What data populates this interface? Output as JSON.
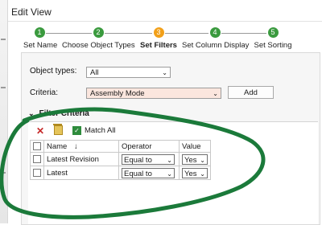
{
  "window": {
    "title": "Edit View"
  },
  "steps": [
    {
      "number": "1",
      "label": "Set Name",
      "state": "done"
    },
    {
      "number": "2",
      "label": "Choose Object Types",
      "state": "done"
    },
    {
      "number": "3",
      "label": "Set Filters",
      "state": "active"
    },
    {
      "number": "4",
      "label": "Set Column Display",
      "state": "done"
    },
    {
      "number": "5",
      "label": "Set Sorting",
      "state": "done"
    }
  ],
  "form": {
    "object_types_label": "Object types:",
    "object_types_value": "All",
    "criteria_label": "Criteria:",
    "criteria_value": "Assembly Mode",
    "add_label": "Add"
  },
  "filter": {
    "section_title": "Filter Criteria",
    "match_all_label": "Match All",
    "match_all_checked": true,
    "columns": {
      "name": "Name",
      "sort_indicator": "↓",
      "operator": "Operator",
      "value": "Value"
    },
    "rows": [
      {
        "name": "Latest Revision",
        "operator": "Equal to",
        "value": "Yes"
      },
      {
        "name": "Latest",
        "operator": "Equal to",
        "value": "Yes"
      }
    ]
  },
  "colors": {
    "step_done": "#3a9a3e",
    "step_active": "#f2a019",
    "annotation_marker": "#1b7a3a",
    "delete_icon": "#c62828"
  },
  "icons": [
    "caret-down-icon",
    "delete-x-icon",
    "clipboard-icon",
    "checkbox-icon",
    "chevron-down-icon"
  ]
}
